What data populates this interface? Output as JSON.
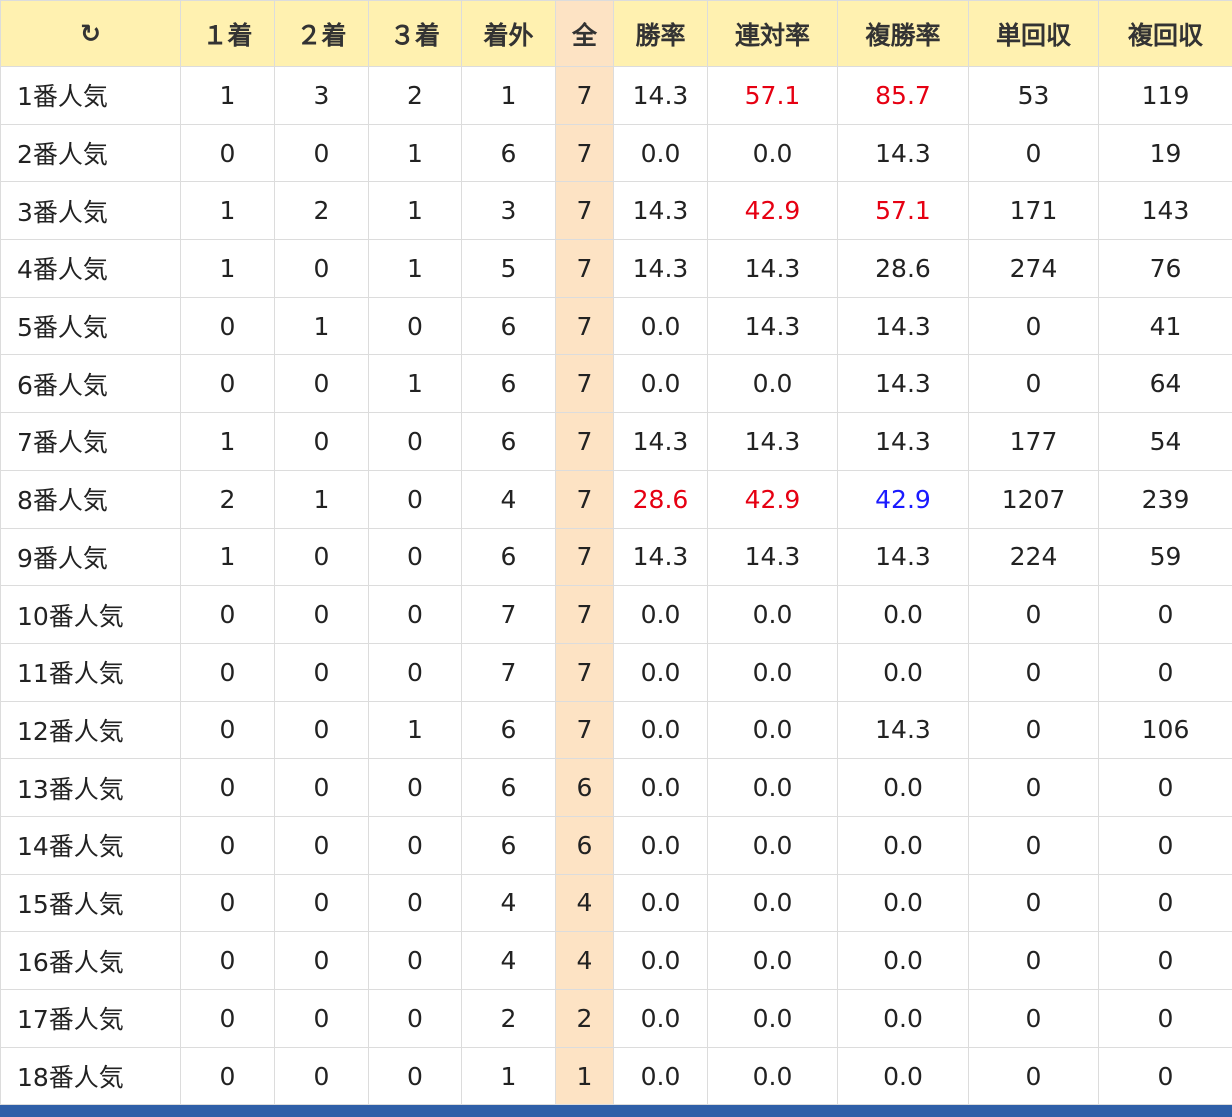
{
  "header": {
    "sort_icon": "refresh-icon",
    "sort_glyph": "↻",
    "columns": [
      "１着",
      "２着",
      "３着",
      "着外",
      "全",
      "勝率",
      "連対率",
      "複勝率",
      "単回収",
      "複回収"
    ]
  },
  "colors": {
    "header_bg": "#fff1b0",
    "total_bg": "#fde3c4",
    "highlight_red": "#e60012",
    "highlight_blue": "#1a1aff",
    "bottom_bar": "#2f5fa8"
  },
  "rows": [
    {
      "label": "1番人気",
      "c1": "1",
      "c2": "3",
      "c3": "2",
      "out": "1",
      "total": "7",
      "win": "14.3",
      "quin": "57.1",
      "place": "85.7",
      "tan": "53",
      "fuku": "119",
      "hl": {
        "quin": "red",
        "place": "red"
      }
    },
    {
      "label": "2番人気",
      "c1": "0",
      "c2": "0",
      "c3": "1",
      "out": "6",
      "total": "7",
      "win": "0.0",
      "quin": "0.0",
      "place": "14.3",
      "tan": "0",
      "fuku": "19",
      "hl": {}
    },
    {
      "label": "3番人気",
      "c1": "1",
      "c2": "2",
      "c3": "1",
      "out": "3",
      "total": "7",
      "win": "14.3",
      "quin": "42.9",
      "place": "57.1",
      "tan": "171",
      "fuku": "143",
      "hl": {
        "quin": "red",
        "place": "red"
      }
    },
    {
      "label": "4番人気",
      "c1": "1",
      "c2": "0",
      "c3": "1",
      "out": "5",
      "total": "7",
      "win": "14.3",
      "quin": "14.3",
      "place": "28.6",
      "tan": "274",
      "fuku": "76",
      "hl": {}
    },
    {
      "label": "5番人気",
      "c1": "0",
      "c2": "1",
      "c3": "0",
      "out": "6",
      "total": "7",
      "win": "0.0",
      "quin": "14.3",
      "place": "14.3",
      "tan": "0",
      "fuku": "41",
      "hl": {}
    },
    {
      "label": "6番人気",
      "c1": "0",
      "c2": "0",
      "c3": "1",
      "out": "6",
      "total": "7",
      "win": "0.0",
      "quin": "0.0",
      "place": "14.3",
      "tan": "0",
      "fuku": "64",
      "hl": {}
    },
    {
      "label": "7番人気",
      "c1": "1",
      "c2": "0",
      "c3": "0",
      "out": "6",
      "total": "7",
      "win": "14.3",
      "quin": "14.3",
      "place": "14.3",
      "tan": "177",
      "fuku": "54",
      "hl": {}
    },
    {
      "label": "8番人気",
      "c1": "2",
      "c2": "1",
      "c3": "0",
      "out": "4",
      "total": "7",
      "win": "28.6",
      "quin": "42.9",
      "place": "42.9",
      "tan": "1207",
      "fuku": "239",
      "hl": {
        "win": "red",
        "quin": "red",
        "place": "blue"
      }
    },
    {
      "label": "9番人気",
      "c1": "1",
      "c2": "0",
      "c3": "0",
      "out": "6",
      "total": "7",
      "win": "14.3",
      "quin": "14.3",
      "place": "14.3",
      "tan": "224",
      "fuku": "59",
      "hl": {}
    },
    {
      "label": "10番人気",
      "c1": "0",
      "c2": "0",
      "c3": "0",
      "out": "7",
      "total": "7",
      "win": "0.0",
      "quin": "0.0",
      "place": "0.0",
      "tan": "0",
      "fuku": "0",
      "hl": {}
    },
    {
      "label": "11番人気",
      "c1": "0",
      "c2": "0",
      "c3": "0",
      "out": "7",
      "total": "7",
      "win": "0.0",
      "quin": "0.0",
      "place": "0.0",
      "tan": "0",
      "fuku": "0",
      "hl": {}
    },
    {
      "label": "12番人気",
      "c1": "0",
      "c2": "0",
      "c3": "1",
      "out": "6",
      "total": "7",
      "win": "0.0",
      "quin": "0.0",
      "place": "14.3",
      "tan": "0",
      "fuku": "106",
      "hl": {}
    },
    {
      "label": "13番人気",
      "c1": "0",
      "c2": "0",
      "c3": "0",
      "out": "6",
      "total": "6",
      "win": "0.0",
      "quin": "0.0",
      "place": "0.0",
      "tan": "0",
      "fuku": "0",
      "hl": {}
    },
    {
      "label": "14番人気",
      "c1": "0",
      "c2": "0",
      "c3": "0",
      "out": "6",
      "total": "6",
      "win": "0.0",
      "quin": "0.0",
      "place": "0.0",
      "tan": "0",
      "fuku": "0",
      "hl": {}
    },
    {
      "label": "15番人気",
      "c1": "0",
      "c2": "0",
      "c3": "0",
      "out": "4",
      "total": "4",
      "win": "0.0",
      "quin": "0.0",
      "place": "0.0",
      "tan": "0",
      "fuku": "0",
      "hl": {}
    },
    {
      "label": "16番人気",
      "c1": "0",
      "c2": "0",
      "c3": "0",
      "out": "4",
      "total": "4",
      "win": "0.0",
      "quin": "0.0",
      "place": "0.0",
      "tan": "0",
      "fuku": "0",
      "hl": {}
    },
    {
      "label": "17番人気",
      "c1": "0",
      "c2": "0",
      "c3": "0",
      "out": "2",
      "total": "2",
      "win": "0.0",
      "quin": "0.0",
      "place": "0.0",
      "tan": "0",
      "fuku": "0",
      "hl": {}
    },
    {
      "label": "18番人気",
      "c1": "0",
      "c2": "0",
      "c3": "0",
      "out": "1",
      "total": "1",
      "win": "0.0",
      "quin": "0.0",
      "place": "0.0",
      "tan": "0",
      "fuku": "0",
      "hl": {}
    }
  ]
}
